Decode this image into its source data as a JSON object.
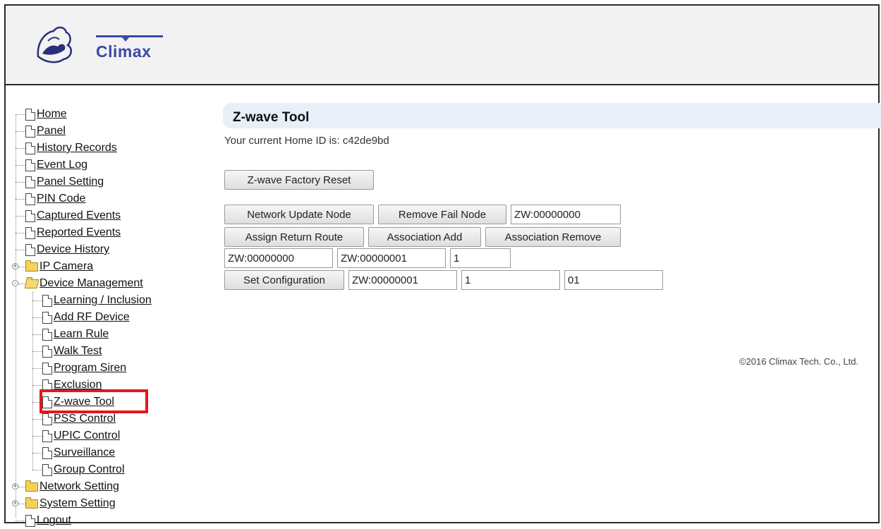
{
  "logo": {
    "text": "Climax"
  },
  "nav": {
    "items": [
      {
        "label": "Home",
        "type": "doc"
      },
      {
        "label": "Panel",
        "type": "doc"
      },
      {
        "label": "History Records",
        "type": "doc"
      },
      {
        "label": "Event Log",
        "type": "doc"
      },
      {
        "label": "Panel Setting",
        "type": "doc"
      },
      {
        "label": "PIN Code",
        "type": "doc"
      },
      {
        "label": "Captured Events",
        "type": "doc"
      },
      {
        "label": "Reported Events",
        "type": "doc"
      },
      {
        "label": "Device History",
        "type": "doc"
      },
      {
        "label": "IP Camera",
        "type": "folder",
        "expander": "+"
      },
      {
        "label": "Device Management",
        "type": "folder-open",
        "expander": "-"
      },
      {
        "label": "Network Setting",
        "type": "folder",
        "expander": "+"
      },
      {
        "label": "System Setting",
        "type": "folder",
        "expander": "+"
      },
      {
        "label": "Logout",
        "type": "doc"
      }
    ],
    "device_management_children": [
      {
        "label": "Learning / Inclusion"
      },
      {
        "label": "Add RF Device"
      },
      {
        "label": "Learn Rule"
      },
      {
        "label": "Walk Test"
      },
      {
        "label": "Program Siren"
      },
      {
        "label": "Exclusion"
      },
      {
        "label": "Z-wave Tool",
        "selected": true
      },
      {
        "label": "PSS Control"
      },
      {
        "label": "UPIC Control"
      },
      {
        "label": "Surveillance"
      },
      {
        "label": "Group Control"
      }
    ]
  },
  "main": {
    "title": "Z-wave Tool",
    "home_id_text": "Your current Home ID is: c42de9bd",
    "factory_reset_label": "Z-wave Factory Reset",
    "network_update_label": "Network Update Node",
    "remove_fail_label": "Remove Fail Node",
    "node_field_value": "ZW:00000000",
    "assign_route_label": "Assign Return Route",
    "assoc_add_label": "Association Add",
    "assoc_remove_label": "Association Remove",
    "assoc_src_value": "ZW:00000000",
    "assoc_dst_value": "ZW:00000001",
    "assoc_group_value": "1",
    "set_config_label": "Set Configuration",
    "config_node_value": "ZW:00000001",
    "config_param_value": "1",
    "config_value_value": "01"
  },
  "footer": {
    "copyright": "©2016 Climax Tech. Co., Ltd."
  },
  "colors": {
    "accent_red": "#e3171b",
    "title_bar": "#e9eff8",
    "logo_blue": "#3a4aa8"
  }
}
